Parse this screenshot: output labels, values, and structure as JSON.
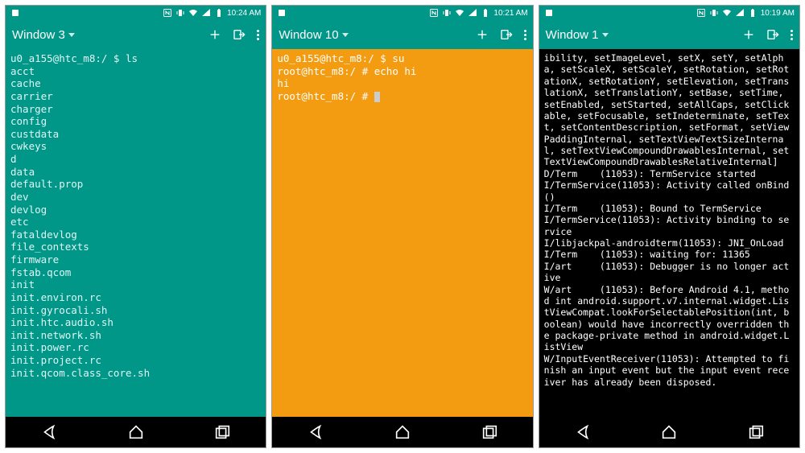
{
  "phones": [
    {
      "statusbar": {
        "time": "10:24 AM"
      },
      "appbar": {
        "title": "Window 3"
      },
      "terminal": {
        "bg": "#009688",
        "fg": "#e0f7f4",
        "lines": [
          "u0_a155@htc_m8:/ $ ls",
          "acct",
          "cache",
          "carrier",
          "charger",
          "config",
          "custdata",
          "cwkeys",
          "d",
          "data",
          "default.prop",
          "dev",
          "devlog",
          "etc",
          "fataldevlog",
          "file_contexts",
          "firmware",
          "fstab.qcom",
          "init",
          "init.environ.rc",
          "init.gyrocali.sh",
          "init.htc.audio.sh",
          "init.network.sh",
          "init.power.rc",
          "init.project.rc",
          "init.qcom.class_core.sh"
        ]
      }
    },
    {
      "statusbar": {
        "time": "10:21 AM"
      },
      "appbar": {
        "title": "Window 10"
      },
      "terminal": {
        "bg": "#f39c12",
        "fg": "#ffffff",
        "lines": [
          "u0_a155@htc_m8:/ $ su",
          "root@htc_m8:/ # echo hi",
          "hi",
          "root@htc_m8:/ # "
        ],
        "cursor": true
      }
    },
    {
      "statusbar": {
        "time": "10:19 AM"
      },
      "appbar": {
        "title": "Window 1"
      },
      "terminal": {
        "bg": "#000000",
        "fg": "#ffffff",
        "lines": [
          "ibility, setImageLevel, setX, setY, setAlpha, setScaleX, setScaleY, setRotation, setRotationX, setRotationY, setElevation, setTranslationX, setTranslationY, setBase, setTime, setEnabled, setStarted, setAllCaps, setClickable, setFocusable, setIndeterminate, setText, setContentDescription, setFormat, setViewPaddingInternal, setTextViewTextSizeInternal, setTextViewCompoundDrawablesInternal, setTextViewCompoundDrawablesRelativeInternal]",
          "D/Term    (11053): TermService started",
          "I/TermService(11053): Activity called onBind()",
          "I/Term    (11053): Bound to TermService",
          "I/TermService(11053): Activity binding to service",
          "I/libjackpal-androidterm(11053): JNI_OnLoad",
          "I/Term    (11053): waiting for: 11365",
          "I/art     (11053): Debugger is no longer active",
          "W/art     (11053): Before Android 4.1, method int android.support.v7.internal.widget.ListViewCompat.lookForSelectablePosition(int, boolean) would have incorrectly overridden the package-private method in android.widget.ListView",
          "W/InputEventReceiver(11053): Attempted to finish an input event but the input event receiver has already been disposed."
        ]
      }
    }
  ],
  "icons": {
    "add": "add-icon",
    "exit": "exit-icon",
    "menu": "menu-icon",
    "back": "back-icon",
    "home": "home-icon",
    "recent": "recent-icon",
    "nfc": "nfc-icon",
    "vibrate": "vibrate-icon",
    "wifi": "wifi-icon",
    "signal": "signal-icon",
    "battery": "battery-icon"
  }
}
